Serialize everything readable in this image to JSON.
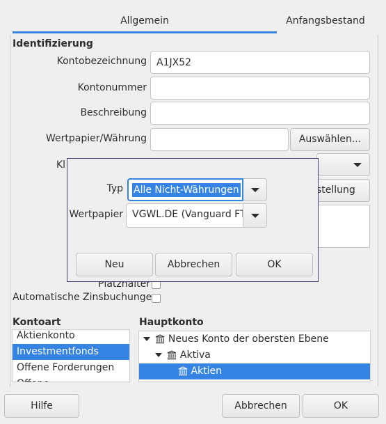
{
  "tabs": [
    {
      "label": "Allgemein",
      "active": true
    },
    {
      "label": "Anfangsbestand",
      "active": false
    }
  ],
  "identification": {
    "heading": "Identifizierung",
    "kontobezeichnung_label": "Kontobezeichnung",
    "kontobezeichnung_value": "A1JX52",
    "kontonummer_label": "Kontonummer",
    "kontonummer_value": "",
    "beschreibung_label": "Beschreibung",
    "beschreibung_value": "",
    "wertpapier_label": "Wertpapier/Währung",
    "wertpapier_value": "",
    "auswaehlen_button": "Auswählen...",
    "partial_label": "Kl",
    "partial_button": "stellung"
  },
  "options": {
    "platzhalter_label": "Platzhalter",
    "platzhalter_checked": false,
    "zinsbuchungen_label": "Automatische Zinsbuchungen",
    "zinsbuchungen_checked": false
  },
  "kontoart": {
    "heading": "Kontoart",
    "items": [
      "Aktienkonto",
      "Investmentfonds",
      "Offene Forderungen",
      "Offene Verbindlichkeiten"
    ],
    "selected_index": 1
  },
  "hauptkonto": {
    "heading": "Hauptkonto",
    "tree": [
      {
        "label": "Neues Konto der obersten Ebene",
        "level": 0,
        "expanded": true
      },
      {
        "label": "Aktiva",
        "level": 1,
        "expanded": true
      },
      {
        "label": "Aktien",
        "level": 2,
        "selected": true
      }
    ]
  },
  "dialog": {
    "typ_label": "Typ",
    "typ_value": "Alle Nicht-Währungen",
    "wertpapier_label": "Wertpapier",
    "wertpapier_value": "VGWL.DE (Vanguard FT",
    "neu_button": "Neu",
    "abbrechen_button": "Abbrechen",
    "ok_button": "OK"
  },
  "footer": {
    "hilfe_button": "Hilfe",
    "abbrechen_button": "Abbrechen",
    "ok_button": "OK"
  },
  "colors": {
    "accent": "#3584e4",
    "dialog_border": "#3d3d7a"
  }
}
